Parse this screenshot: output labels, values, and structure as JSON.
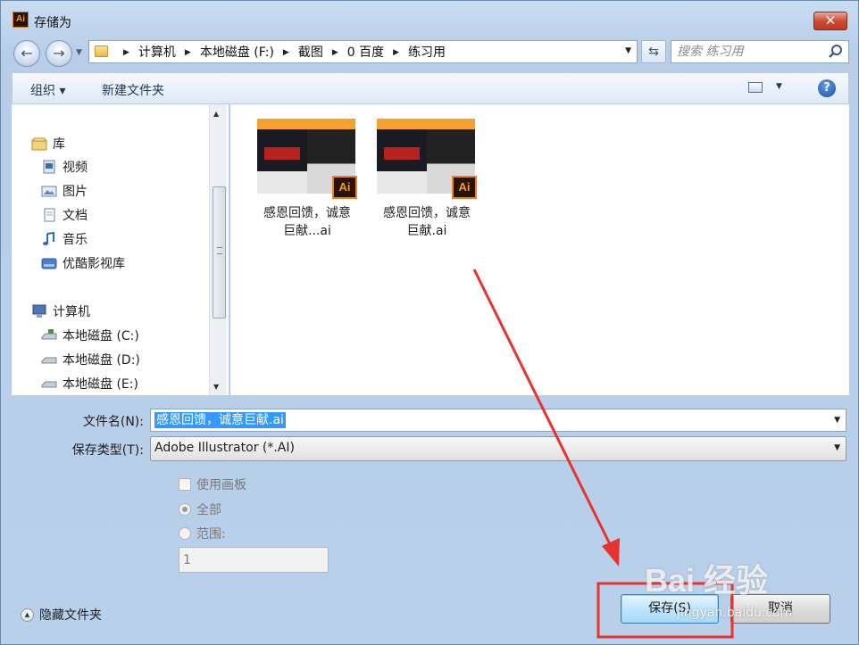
{
  "window": {
    "title": "存储为",
    "app_icon": "Ai",
    "close_glyph": "✕"
  },
  "address": {
    "crumbs": [
      "计算机",
      "本地磁盘 (F:)",
      "截图",
      "0 百度",
      "练习用"
    ]
  },
  "search": {
    "placeholder": "搜索 练习用"
  },
  "toolbar": {
    "organize": "组织 ▾",
    "new_folder": "新建文件夹",
    "help": "?"
  },
  "nav": {
    "items": [
      {
        "label": "库",
        "icon": "library-icon"
      },
      {
        "label": "视频",
        "icon": "video-icon"
      },
      {
        "label": "图片",
        "icon": "pictures-icon"
      },
      {
        "label": "文档",
        "icon": "documents-icon"
      },
      {
        "label": "音乐",
        "icon": "music-icon"
      },
      {
        "label": "优酷影视库",
        "icon": "youku-icon"
      },
      {
        "label": "计算机",
        "icon": "computer-icon"
      },
      {
        "label": "本地磁盘 (C:)",
        "icon": "drive-c-icon"
      },
      {
        "label": "本地磁盘 (D:)",
        "icon": "drive-icon"
      },
      {
        "label": "本地磁盘 (E:)",
        "icon": "drive-icon"
      }
    ]
  },
  "files": [
    {
      "name_line1": "感恩回馈，诚意",
      "name_line2": "巨献...ai",
      "badge": "Ai",
      "thumb_header": "AI"
    },
    {
      "name_line1": "感恩回馈，诚意",
      "name_line2": "巨献.ai",
      "badge": "Ai",
      "thumb_header": "AI"
    }
  ],
  "form": {
    "filename_label": "文件名(N):",
    "filename_value": "感恩回馈，诚意巨献.ai",
    "type_label": "保存类型(T):",
    "type_value": "Adobe Illustrator (*.AI)",
    "artboards_label": "使用画板",
    "all_label": "全部",
    "range_label": "范围:",
    "range_value": "1"
  },
  "footer": {
    "hide_folders": "隐藏文件夹",
    "save": "保存(S)",
    "cancel": "取消"
  },
  "watermark": {
    "text": "Bai 经验",
    "sub": "jingyan.baidu.com"
  },
  "colors": {
    "annotation": "#e8322f",
    "selection": "#3399ff"
  }
}
